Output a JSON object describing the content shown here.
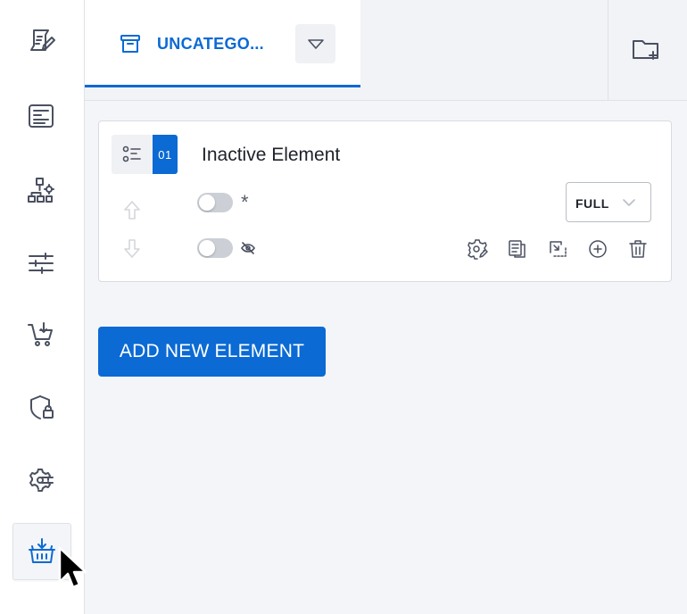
{
  "sidebar": {
    "items": [
      {
        "name": "form-editor-icon"
      },
      {
        "name": "layout-icon"
      },
      {
        "name": "hierarchy-settings-icon"
      },
      {
        "name": "sliders-icon"
      },
      {
        "name": "cart-icon"
      },
      {
        "name": "shield-lock-icon"
      },
      {
        "name": "gear-connections-icon"
      },
      {
        "name": "basket-download-icon",
        "active": true
      }
    ]
  },
  "tabs": {
    "active_label": "UNCATEGO..."
  },
  "element": {
    "number": "01",
    "title": "Inactive Element",
    "required_marker": "*",
    "width_option": "FULL",
    "required_enabled": false,
    "visible_enabled": false
  },
  "actions": {
    "add_label": "ADD NEW ELEMENT"
  },
  "colors": {
    "accent": "#0b6ad4",
    "sidebar_bg": "#ffffff",
    "content_bg": "#f4f5f8",
    "icon_gray": "#4a5060"
  }
}
